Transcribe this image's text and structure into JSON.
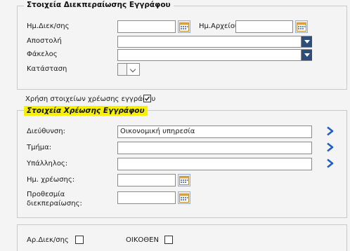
{
  "processing_section": {
    "title": "Στοιχεία Διεκπεραίωσης Εγγράφου",
    "fields": {
      "processing_date": {
        "label": "Ημ.Διεκ/σης",
        "value": ""
      },
      "archive_date": {
        "label": "Ημ.Αρχείου",
        "value": ""
      },
      "dispatch": {
        "label": "Αποστολή",
        "value": ""
      },
      "folder": {
        "label": "Φάκελος",
        "value": ""
      },
      "status": {
        "label": "Κατάσταση",
        "value": ""
      }
    }
  },
  "charge_toggle": {
    "label": "Χρήση στοιχείων χρέωσης εγγράφου",
    "checked": true
  },
  "charge_section": {
    "title": "Στοιχεία Χρέωσης Εγγράφου",
    "fields": {
      "address": {
        "label": "Διεύθυνση:",
        "value": "Οικονομική υπηρεσία"
      },
      "department": {
        "label": "Τμήμα:",
        "value": ""
      },
      "employee": {
        "label": "Υπάλληλος:",
        "value": ""
      },
      "charge_date": {
        "label": "Ημ. χρέωσης:",
        "value": ""
      },
      "deadline_line1": "Προθεσμία",
      "deadline_line2": "διεκπεραίωσης:",
      "deadline_value": ""
    }
  },
  "bottom": {
    "processing_no": {
      "label": "Αρ.Διεκ/σης",
      "checked": false
    },
    "ex_officio": {
      "label": "ΟΙΚΟΘΕΝ",
      "checked": false
    }
  },
  "colors": {
    "accent_dropdown": "#2d4d7a",
    "arrow_icon": "#1f5fc4",
    "highlight": "#f7f100"
  },
  "icons": [
    "calendar-icon",
    "chevron-down-icon",
    "chevron-right-icon",
    "checkbox-checked-icon"
  ]
}
